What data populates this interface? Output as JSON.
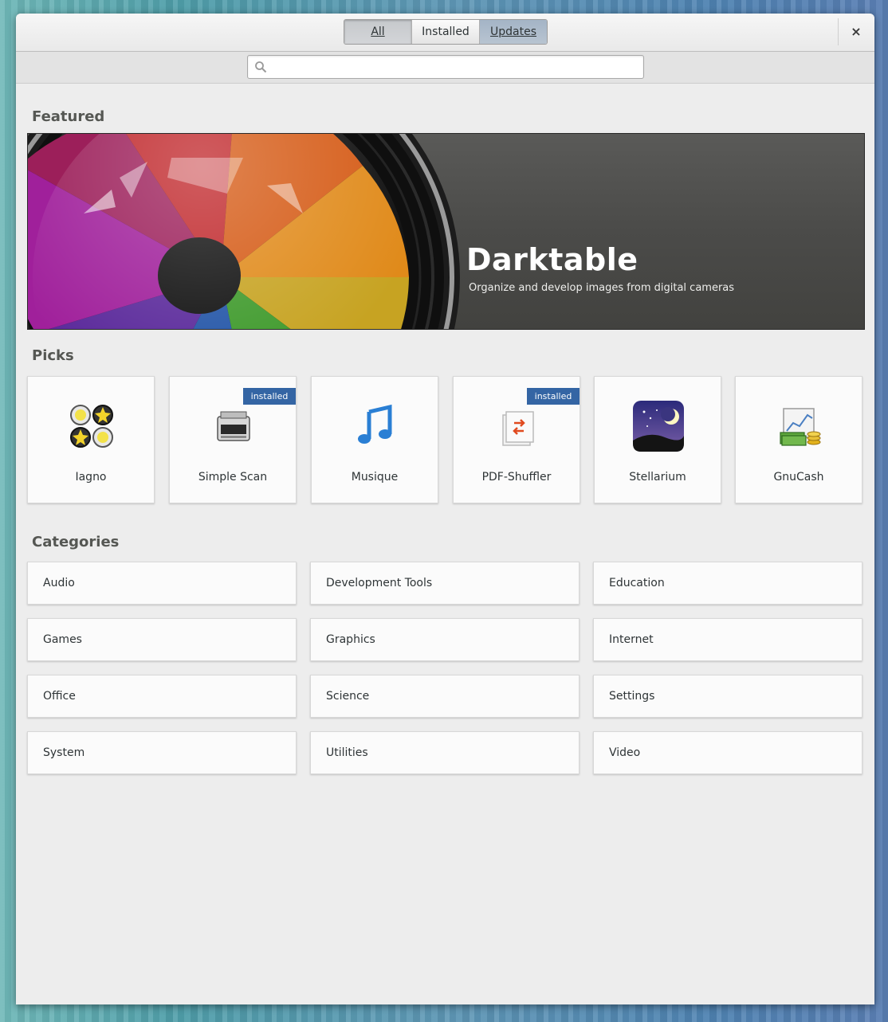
{
  "header": {
    "tabs": [
      {
        "label": "All"
      },
      {
        "label": "Installed"
      },
      {
        "label": "Updates"
      }
    ],
    "close_icon": "×"
  },
  "search": {
    "placeholder": "",
    "value": ""
  },
  "featured": {
    "section_title": "Featured",
    "app_name": "Darktable",
    "description": "Organize and develop images from digital cameras"
  },
  "picks": {
    "section_title": "Picks",
    "badge_text": "installed",
    "items": [
      {
        "name": "Iagno",
        "icon": "iagno-icon",
        "installed": false
      },
      {
        "name": "Simple Scan",
        "icon": "scanner-icon",
        "installed": true
      },
      {
        "name": "Musique",
        "icon": "music-note-icon",
        "installed": false
      },
      {
        "name": "PDF-Shuffler",
        "icon": "pdf-shuffler-icon",
        "installed": true
      },
      {
        "name": "Stellarium",
        "icon": "stellarium-icon",
        "installed": false
      },
      {
        "name": "GnuCash",
        "icon": "gnucash-icon",
        "installed": false
      }
    ]
  },
  "categories": {
    "section_title": "Categories",
    "items": [
      "Audio",
      "Development Tools",
      "Education",
      "Games",
      "Graphics",
      "Internet",
      "Office",
      "Science",
      "Settings",
      "System",
      "Utilities",
      "Video"
    ]
  },
  "colors": {
    "badge": "#3465a4",
    "selected_tab": "#b8c4d1"
  }
}
